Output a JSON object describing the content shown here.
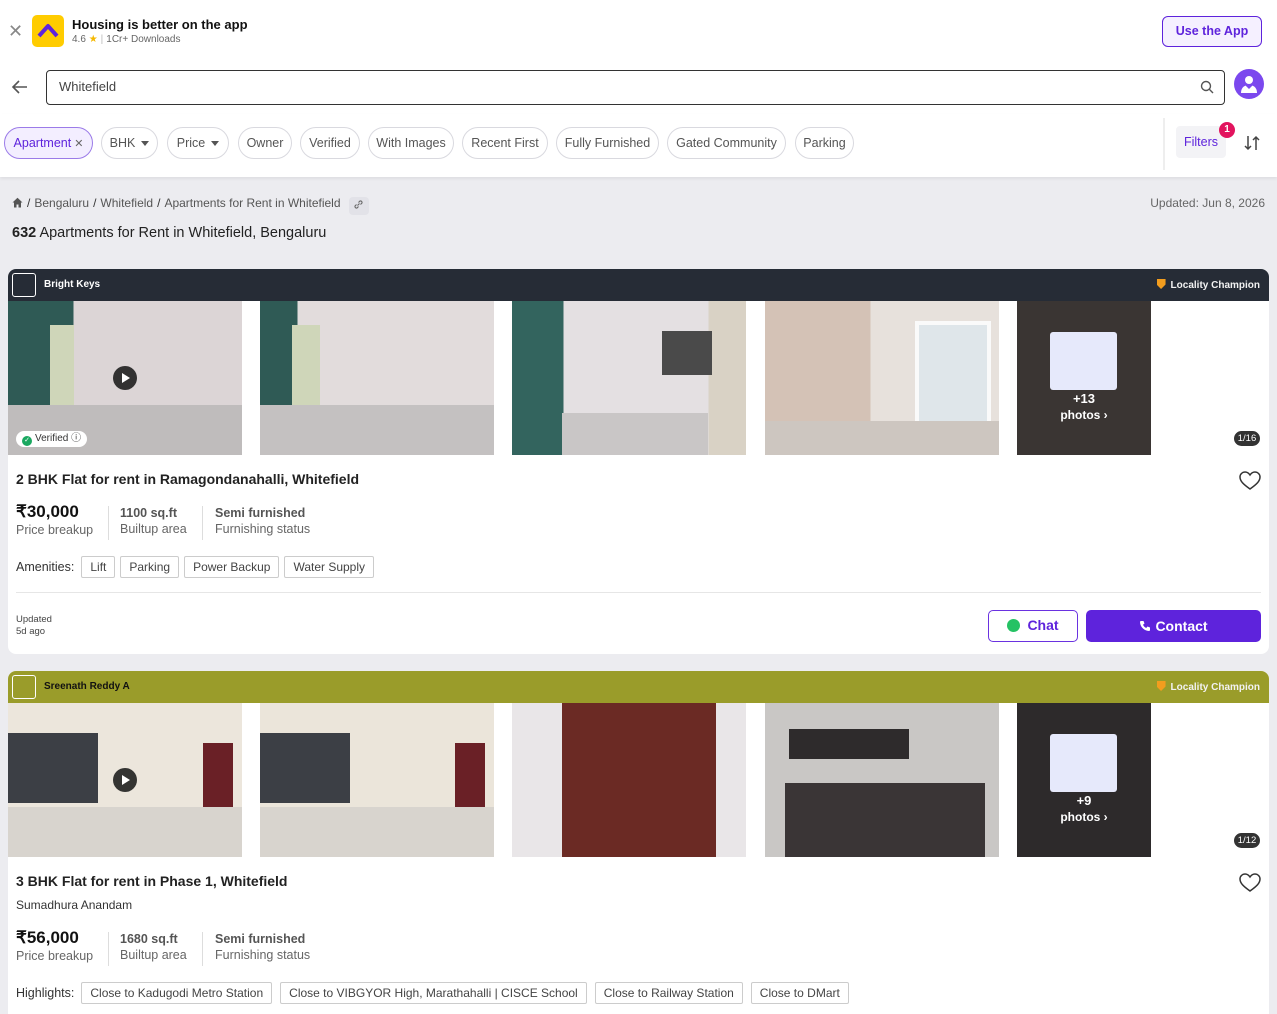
{
  "banner": {
    "title": "Housing is better on the app",
    "rating": "4.6",
    "star": "★",
    "downloads": "1Cr+ Downloads",
    "cta": "Use the App"
  },
  "search": {
    "value": "Whitefield"
  },
  "filters": {
    "chips": [
      "Apartment",
      "BHK",
      "Price",
      "Owner",
      "Verified",
      "With Images",
      "Recent First",
      "Fully Furnished",
      "Gated Community",
      "Parking"
    ],
    "filters_label": "Filters",
    "filters_count": "1"
  },
  "breadcrumb": {
    "items": [
      "Bengaluru",
      "Whitefield",
      "Apartments for Rent in Whitefield"
    ],
    "separator": "/",
    "updated": "Updated: Jun 8, 2026"
  },
  "results": {
    "count": "632",
    "heading": "Apartments for Rent in Whitefield, Bengaluru"
  },
  "listings": [
    {
      "agent": "Bright Keys",
      "badge": "Locality Champion",
      "header_color": "#262c36",
      "verified": "Verified",
      "more_count": "+13",
      "more_label": "photos",
      "photo_counter": "1/16",
      "title": "2 BHK Flat for rent in Ramagondanahalli, Whitefield",
      "price": "30,000",
      "price_label": "Price breakup",
      "area": "1100 sq.ft",
      "area_label": "Builtup area",
      "furnishing": "Semi furnished",
      "furnishing_label": "Furnishing status",
      "tags_label": "Amenities:",
      "tags": [
        "Lift",
        "Parking",
        "Power Backup",
        "Water Supply"
      ],
      "updated_label": "Updated",
      "updated_value": "5d ago",
      "chat": "Chat",
      "contact": "Contact"
    },
    {
      "agent": "Sreenath Reddy A",
      "badge": "Locality Champion",
      "header_color": "#9a9c2a",
      "more_count": "+9",
      "more_label": "photos",
      "photo_counter": "1/12",
      "title": "3 BHK Flat for rent in Phase 1, Whitefield",
      "subtitle": "Sumadhura Anandam",
      "price": "56,000",
      "price_label": "Price breakup",
      "area": "1680 sq.ft",
      "area_label": "Builtup area",
      "furnishing": "Semi furnished",
      "furnishing_label": "Furnishing status",
      "tags_label": "Highlights:",
      "tags": [
        "Close to Kadugodi Metro Station",
        "Close to VIBGYOR High, Marathahalli | CISCE School",
        "Close to Railway Station",
        "Close to DMart"
      ]
    }
  ],
  "currency": "₹",
  "icons": [
    "close-icon",
    "housing-logo-icon",
    "back-arrow-icon",
    "search-icon",
    "avatar-icon",
    "sort-icon",
    "home-icon",
    "link-icon",
    "play-icon",
    "heart-icon",
    "whatsapp-icon",
    "phone-icon"
  ]
}
